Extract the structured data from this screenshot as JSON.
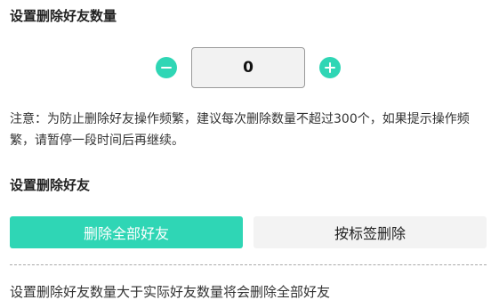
{
  "count_section": {
    "title": "设置删除好友数量",
    "quantity": "0",
    "note": "注意：为防止删除好友操作频繁，建议每次删除数量不超过300个，如果提示操作频繁，请暂停一段时间后再继续。"
  },
  "delete_section": {
    "title": "设置删除好友",
    "delete_all_label": "删除全部好友",
    "delete_by_tag_label": "按标签删除",
    "footer_note": "设置删除好友数量大于实际好友数量将会删除全部好友"
  },
  "icons": {
    "decrement": "minus-circle-icon",
    "increment": "plus-circle-icon"
  },
  "colors": {
    "accent": "#2fd6b5",
    "secondary_button_bg": "#f3f3f3",
    "quantity_box_bg": "#f2f2f2"
  }
}
